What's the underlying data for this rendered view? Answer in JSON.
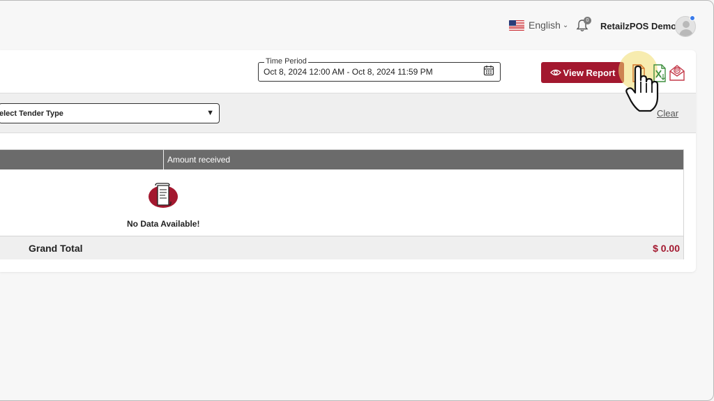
{
  "header": {
    "language": "English",
    "notification_count": "0",
    "user_name": "RetailzPOS Demo"
  },
  "filters": {
    "time_period_label": "Time Period",
    "time_period_value": "Oct 8, 2024 12:00 AM - Oct 8, 2024 11:59 PM",
    "view_report_label": "View Report",
    "tender_type_placeholder": "elect Tender Type",
    "clear_label": "Clear"
  },
  "table": {
    "columns": [
      "Amount received"
    ],
    "empty_message": "No Data Available!",
    "grand_total_label": "Grand Total",
    "grand_total_value": "$ 0.00"
  },
  "colors": {
    "accent": "#a3182f",
    "table_header": "#6b6b6b",
    "highlight": "#f0dc6e"
  },
  "icons": [
    "flag-us-icon",
    "chevron-down-icon",
    "bell-icon",
    "avatar-icon",
    "calendar-icon",
    "eye-icon",
    "pdf-export-icon",
    "excel-export-icon",
    "email-export-icon",
    "caret-down-icon",
    "no-data-icon",
    "pointer-hand-icon"
  ]
}
